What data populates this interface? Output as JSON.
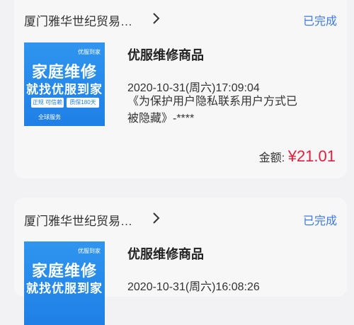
{
  "orders": [
    {
      "store": "厦门雅华世纪贸易…",
      "status": "已完成",
      "product_title": "优服维修商品",
      "datetime": "2020-10-31(周六)17:09:04",
      "privacy_note": "《为保护用户隐私联系用户方式已被隐藏》-****",
      "amount_label": "金额:",
      "amount_value": "¥21.01",
      "thumbnail": {
        "brand": "优服到家",
        "headline1": "家庭维修",
        "headline2": "就找优服到家",
        "badge_left": "正规 可信赖",
        "badge_right": "质保180天",
        "footer": "全球服务"
      }
    },
    {
      "store": "厦门雅华世纪贸易…",
      "status": "已完成",
      "product_title": "优服维修商品",
      "datetime": "2020-10-31(周六)16:08:26",
      "thumbnail": {
        "brand": "优服到家",
        "headline1": "家庭维修",
        "headline2": "就找优服到家"
      }
    }
  ],
  "colors": {
    "status_blue": "#3e79e6",
    "price_red": "#e0213b",
    "thumb_blue": "#2f95ef"
  }
}
